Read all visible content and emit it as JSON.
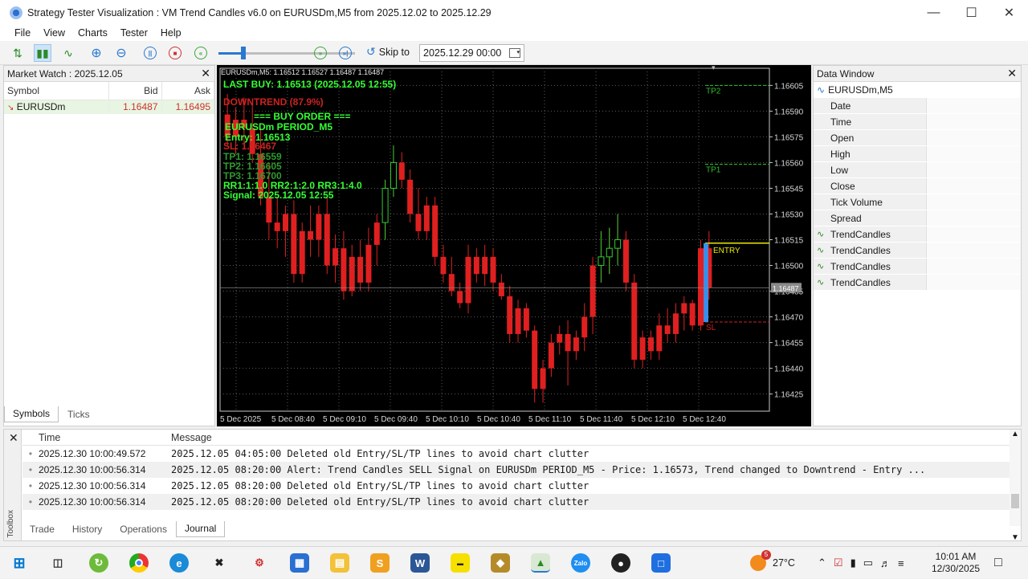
{
  "window": {
    "title": "Strategy Tester Visualization : VM Trend Candles v6.0 on EURUSDm,M5 from 2025.12.02 to 2025.12.29"
  },
  "menu": [
    "File",
    "View",
    "Charts",
    "Tester",
    "Help"
  ],
  "toolbar": {
    "skip_to_label": "Skip to",
    "skip_to_value": "2025.12.29 00:00",
    "slider_fraction": 0.18
  },
  "market_watch": {
    "title": "Market Watch : 2025.12.05",
    "columns": [
      "Symbol",
      "Bid",
      "Ask"
    ],
    "rows": [
      {
        "symbol": "EURUSDm",
        "bid": "1.16487",
        "ask": "1.16495"
      }
    ],
    "tabs": [
      "Symbols",
      "Ticks"
    ]
  },
  "chart": {
    "header": "EURUSDm,M5: 1.16512 1.16527 1.16487 1.16487",
    "overlay": [
      {
        "text": "LAST BUY: 1.16513 (2025.12.05 12:55)",
        "color": "#33ff33"
      },
      {
        "text": "DOWNTREND (87.9%)",
        "color": "#cc2222"
      },
      {
        "text": "=== BUY ORDER ===",
        "color": "#33ff33"
      },
      {
        "text": "EURUSDm PERIOD_M5",
        "color": "#33ff33"
      },
      {
        "text": "Entry: 1.16513",
        "color": "#33ff33"
      },
      {
        "text": "SL: 1.16467",
        "color": "#cc2222"
      },
      {
        "text": "TP1: 1.16559",
        "color": "#2f9a2f"
      },
      {
        "text": "TP2: 1.16605",
        "color": "#2f9a2f"
      },
      {
        "text": "TP3: 1.16700",
        "color": "#2f9a2f"
      },
      {
        "text": "RR1:1:1.0 RR2:1:2.0 RR3:1:4.0",
        "color": "#33ff33"
      },
      {
        "text": "Signal: 2025.12.05 12:55",
        "color": "#33ff33"
      }
    ],
    "line_labels": {
      "tp2": "TP2",
      "tp1": "TP1",
      "entry": "ENTRY",
      "sl": "SL"
    },
    "price_highlight": "1.16487"
  },
  "chart_data": {
    "type": "candlestick",
    "symbol": "EURUSDm",
    "timeframe": "M5",
    "x_ticks": [
      "5 Dec 2025",
      "5 Dec 08:40",
      "5 Dec 09:10",
      "5 Dec 09:40",
      "5 Dec 10:10",
      "5 Dec 10:40",
      "5 Dec 11:10",
      "5 Dec 11:40",
      "5 Dec 12:10",
      "5 Dec 12:40"
    ],
    "y_ticks": [
      "1.16605",
      "1.16590",
      "1.16575",
      "1.16560",
      "1.16545",
      "1.16530",
      "1.16515",
      "1.16500",
      "1.16485",
      "1.16470",
      "1.16455",
      "1.16440",
      "1.16425"
    ],
    "ylim": [
      1.16415,
      1.16615
    ],
    "levels": {
      "tp2": 1.16605,
      "tp1": 1.16559,
      "entry": 1.16513,
      "sl": 1.16467,
      "bid": 1.16487
    },
    "candles": [
      {
        "o": 1.16588,
        "h": 1.166,
        "l": 1.1657,
        "c": 1.16575
      },
      {
        "o": 1.16575,
        "h": 1.16592,
        "l": 1.16565,
        "c": 1.16585
      },
      {
        "o": 1.16585,
        "h": 1.16598,
        "l": 1.16572,
        "c": 1.1658
      },
      {
        "o": 1.1658,
        "h": 1.16595,
        "l": 1.1656,
        "c": 1.16565
      },
      {
        "o": 1.16565,
        "h": 1.1658,
        "l": 1.16535,
        "c": 1.1654
      },
      {
        "o": 1.1654,
        "h": 1.1656,
        "l": 1.16515,
        "c": 1.16525
      },
      {
        "o": 1.16525,
        "h": 1.1654,
        "l": 1.1651,
        "c": 1.1652
      },
      {
        "o": 1.1652,
        "h": 1.16535,
        "l": 1.16505,
        "c": 1.1653
      },
      {
        "o": 1.1653,
        "h": 1.16538,
        "l": 1.1649,
        "c": 1.16495
      },
      {
        "o": 1.16495,
        "h": 1.16525,
        "l": 1.1649,
        "c": 1.1652
      },
      {
        "o": 1.1652,
        "h": 1.16535,
        "l": 1.16505,
        "c": 1.16515
      },
      {
        "o": 1.16515,
        "h": 1.16535,
        "l": 1.16505,
        "c": 1.1653
      },
      {
        "o": 1.1653,
        "h": 1.1654,
        "l": 1.16495,
        "c": 1.165
      },
      {
        "o": 1.165,
        "h": 1.16518,
        "l": 1.1649,
        "c": 1.1651
      },
      {
        "o": 1.1651,
        "h": 1.1652,
        "l": 1.1648,
        "c": 1.16485
      },
      {
        "o": 1.16485,
        "h": 1.16512,
        "l": 1.16482,
        "c": 1.16505
      },
      {
        "o": 1.16505,
        "h": 1.16515,
        "l": 1.16485,
        "c": 1.1649
      },
      {
        "o": 1.1649,
        "h": 1.16522,
        "l": 1.16485,
        "c": 1.16512
      },
      {
        "o": 1.16512,
        "h": 1.1653,
        "l": 1.165,
        "c": 1.16525
      },
      {
        "o": 1.16525,
        "h": 1.1655,
        "l": 1.16515,
        "c": 1.16545
      },
      {
        "o": 1.16545,
        "h": 1.1657,
        "l": 1.1654,
        "c": 1.1656
      },
      {
        "o": 1.1656,
        "h": 1.16566,
        "l": 1.16545,
        "c": 1.1655
      },
      {
        "o": 1.1655,
        "h": 1.16556,
        "l": 1.16525,
        "c": 1.1653
      },
      {
        "o": 1.1653,
        "h": 1.16545,
        "l": 1.16515,
        "c": 1.1652
      },
      {
        "o": 1.1652,
        "h": 1.1654,
        "l": 1.16515,
        "c": 1.16535
      },
      {
        "o": 1.16535,
        "h": 1.1654,
        "l": 1.165,
        "c": 1.16505
      },
      {
        "o": 1.16505,
        "h": 1.16512,
        "l": 1.1649,
        "c": 1.16495
      },
      {
        "o": 1.16495,
        "h": 1.16505,
        "l": 1.16482,
        "c": 1.16485
      },
      {
        "o": 1.16485,
        "h": 1.1649,
        "l": 1.16475,
        "c": 1.16478
      },
      {
        "o": 1.16478,
        "h": 1.16512,
        "l": 1.16472,
        "c": 1.16505
      },
      {
        "o": 1.16505,
        "h": 1.1651,
        "l": 1.1649,
        "c": 1.16495
      },
      {
        "o": 1.16495,
        "h": 1.16512,
        "l": 1.16488,
        "c": 1.16505
      },
      {
        "o": 1.16505,
        "h": 1.1651,
        "l": 1.16485,
        "c": 1.1649
      },
      {
        "o": 1.1649,
        "h": 1.16495,
        "l": 1.1648,
        "c": 1.16482
      },
      {
        "o": 1.16482,
        "h": 1.16488,
        "l": 1.16455,
        "c": 1.1646
      },
      {
        "o": 1.1646,
        "h": 1.1648,
        "l": 1.16455,
        "c": 1.16475
      },
      {
        "o": 1.16475,
        "h": 1.16478,
        "l": 1.16458,
        "c": 1.16462
      },
      {
        "o": 1.16462,
        "h": 1.16465,
        "l": 1.1642,
        "c": 1.16428
      },
      {
        "o": 1.16428,
        "h": 1.16445,
        "l": 1.1642,
        "c": 1.1644
      },
      {
        "o": 1.1644,
        "h": 1.1646,
        "l": 1.16435,
        "c": 1.16455
      },
      {
        "o": 1.16455,
        "h": 1.16465,
        "l": 1.16448,
        "c": 1.1646
      },
      {
        "o": 1.1646,
        "h": 1.16468,
        "l": 1.1643,
        "c": 1.1645
      },
      {
        "o": 1.1645,
        "h": 1.16462,
        "l": 1.16445,
        "c": 1.16458
      },
      {
        "o": 1.16458,
        "h": 1.16478,
        "l": 1.1645,
        "c": 1.1647
      },
      {
        "o": 1.1647,
        "h": 1.16505,
        "l": 1.1646,
        "c": 1.165
      },
      {
        "o": 1.165,
        "h": 1.1652,
        "l": 1.1649,
        "c": 1.16505
      },
      {
        "o": 1.16505,
        "h": 1.16522,
        "l": 1.16495,
        "c": 1.1651
      },
      {
        "o": 1.1651,
        "h": 1.1653,
        "l": 1.165,
        "c": 1.16515
      },
      {
        "o": 1.16515,
        "h": 1.1652,
        "l": 1.16485,
        "c": 1.1649
      },
      {
        "o": 1.1649,
        "h": 1.16495,
        "l": 1.1644,
        "c": 1.16445
      },
      {
        "o": 1.16445,
        "h": 1.16462,
        "l": 1.1644,
        "c": 1.16458
      },
      {
        "o": 1.16458,
        "h": 1.16462,
        "l": 1.16445,
        "c": 1.1645
      },
      {
        "o": 1.1645,
        "h": 1.16472,
        "l": 1.16445,
        "c": 1.16465
      },
      {
        "o": 1.16465,
        "h": 1.16475,
        "l": 1.16455,
        "c": 1.1646
      },
      {
        "o": 1.1646,
        "h": 1.16478,
        "l": 1.16455,
        "c": 1.16472
      },
      {
        "o": 1.16472,
        "h": 1.16482,
        "l": 1.16462,
        "c": 1.16478
      },
      {
        "o": 1.16478,
        "h": 1.1648,
        "l": 1.16462,
        "c": 1.16465
      },
      {
        "o": 1.16465,
        "h": 1.16515,
        "l": 1.16462,
        "c": 1.1651
      },
      {
        "o": 1.1651,
        "h": 1.1652,
        "l": 1.1648,
        "c": 1.16487
      }
    ]
  },
  "data_window": {
    "title": "Data Window",
    "symbol": "EURUSDm,M5",
    "rows": [
      "Date",
      "Time",
      "Open",
      "High",
      "Low",
      "Close",
      "Tick Volume",
      "Spread"
    ],
    "indicator_rows": [
      "TrendCandles",
      "TrendCandles",
      "TrendCandles",
      "TrendCandles"
    ]
  },
  "journal": {
    "side_label": "Toolbox",
    "columns": [
      "Time",
      "Message"
    ],
    "rows": [
      {
        "time": "2025.12.30 10:00:49.572",
        "message": "2025.12.05 04:05:00   Deleted old Entry/SL/TP lines to avoid chart clutter"
      },
      {
        "time": "2025.12.30 10:00:56.314",
        "message": "2025.12.05 08:20:00   Alert: Trend Candles SELL Signal on EURUSDm PERIOD_M5 - Price: 1.16573, Trend changed to Downtrend - Entry ..."
      },
      {
        "time": "2025.12.30 10:00:56.314",
        "message": "2025.12.05 08:20:00   Deleted old Entry/SL/TP lines to avoid chart clutter"
      },
      {
        "time": "2025.12.30 10:00:56.314",
        "message": "2025.12.05 08:20:00   Deleted old Entry/SL/TP lines to avoid chart clutter"
      }
    ],
    "tabs": [
      "Trade",
      "History",
      "Operations",
      "Journal"
    ]
  },
  "taskbar": {
    "weather": "27°C",
    "weather_badge": "5",
    "time": "10:01 AM",
    "date": "12/30/2025",
    "app_labels": {
      "word": "W",
      "zalo": "Zalo"
    }
  }
}
